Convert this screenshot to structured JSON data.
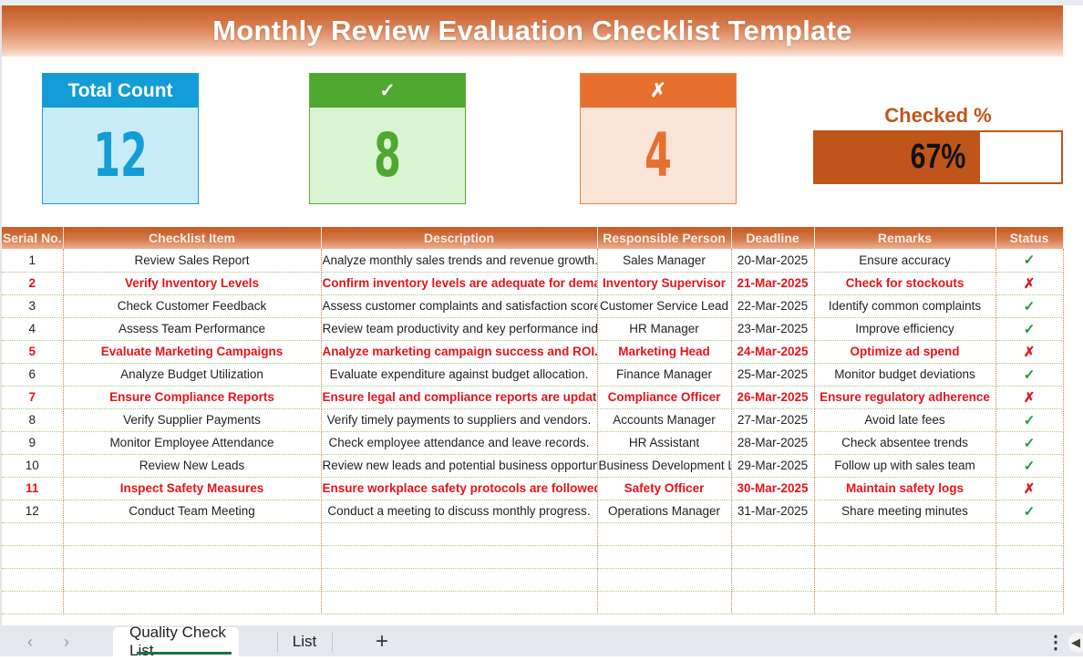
{
  "title": "Monthly Review Evaluation Checklist Template",
  "cards": {
    "total": {
      "label": "Total Count",
      "value": "12"
    },
    "checked": {
      "label": "✓",
      "value": "8"
    },
    "unchecked": {
      "label": "✗",
      "value": "4"
    }
  },
  "checked_pct": {
    "label": "Checked %",
    "value": 0.67,
    "text": "67%"
  },
  "table": {
    "columns": [
      "Serial No.",
      "Checklist Item",
      "Description",
      "Responsible Person",
      "Deadline",
      "Remarks",
      "Status"
    ],
    "rows": [
      {
        "serial": "1",
        "item": "Review Sales Report",
        "description": "Analyze monthly sales trends and revenue growth.",
        "person": "Sales Manager",
        "deadline": "20-Mar-2025",
        "remarks": "Ensure accuracy",
        "status": "✓",
        "flag": false
      },
      {
        "serial": "2",
        "item": "Verify Inventory Levels",
        "description": "Confirm inventory levels are adequate for demand.",
        "person": "Inventory Supervisor",
        "deadline": "21-Mar-2025",
        "remarks": "Check for stockouts",
        "status": "✗",
        "flag": true
      },
      {
        "serial": "3",
        "item": "Check Customer Feedback",
        "description": "Assess customer complaints and satisfaction scores.",
        "person": "Customer Service Lead",
        "deadline": "22-Mar-2025",
        "remarks": "Identify common complaints",
        "status": "✓",
        "flag": false
      },
      {
        "serial": "4",
        "item": "Assess Team Performance",
        "description": "Review team productivity and key performance indicators.",
        "person": "HR Manager",
        "deadline": "23-Mar-2025",
        "remarks": "Improve efficiency",
        "status": "✓",
        "flag": false
      },
      {
        "serial": "5",
        "item": "Evaluate Marketing Campaigns",
        "description": "Analyze marketing campaign success and ROI.",
        "person": "Marketing Head",
        "deadline": "24-Mar-2025",
        "remarks": "Optimize ad spend",
        "status": "✗",
        "flag": true
      },
      {
        "serial": "6",
        "item": "Analyze Budget Utilization",
        "description": "Evaluate expenditure against budget allocation.",
        "person": "Finance Manager",
        "deadline": "25-Mar-2025",
        "remarks": "Monitor budget deviations",
        "status": "✓",
        "flag": false
      },
      {
        "serial": "7",
        "item": "Ensure Compliance Reports",
        "description": "Ensure legal and compliance reports are updated.",
        "person": "Compliance Officer",
        "deadline": "26-Mar-2025",
        "remarks": "Ensure regulatory adherence",
        "status": "✗",
        "flag": true
      },
      {
        "serial": "8",
        "item": "Verify Supplier Payments",
        "description": "Verify timely payments to suppliers and vendors.",
        "person": "Accounts Manager",
        "deadline": "27-Mar-2025",
        "remarks": "Avoid late fees",
        "status": "✓",
        "flag": false
      },
      {
        "serial": "9",
        "item": "Monitor Employee Attendance",
        "description": "Check employee attendance and leave records.",
        "person": "HR Assistant",
        "deadline": "28-Mar-2025",
        "remarks": "Check absentee trends",
        "status": "✓",
        "flag": false
      },
      {
        "serial": "10",
        "item": "Review New Leads",
        "description": "Review new leads and potential business opportunities.",
        "person": "Business Development Lead",
        "deadline": "29-Mar-2025",
        "remarks": "Follow up with sales team",
        "status": "✓",
        "flag": false
      },
      {
        "serial": "11",
        "item": "Inspect Safety Measures",
        "description": "Ensure workplace safety protocols are followed.",
        "person": "Safety Officer",
        "deadline": "30-Mar-2025",
        "remarks": "Maintain safety logs",
        "status": "✗",
        "flag": true
      },
      {
        "serial": "12",
        "item": "Conduct Team Meeting",
        "description": "Conduct a meeting to discuss monthly progress.",
        "person": "Operations Manager",
        "deadline": "31-Mar-2025",
        "remarks": "Share meeting minutes",
        "status": "✓",
        "flag": false
      }
    ]
  },
  "sheet_tabs": {
    "prev_icon": "‹",
    "next_icon": "›",
    "tabs": [
      "Quality Check List",
      "List"
    ],
    "active": "Quality Check List",
    "add_icon": "+",
    "more_icon": "⋮",
    "scroll_icon": "◀"
  },
  "colors": {
    "accent": "#c55a22",
    "total": "#129dd6",
    "checked": "#4fa82f",
    "unchecked": "#e8702f",
    "flag_text": "#e5141b",
    "ok_mark": "#1f9a3b"
  }
}
